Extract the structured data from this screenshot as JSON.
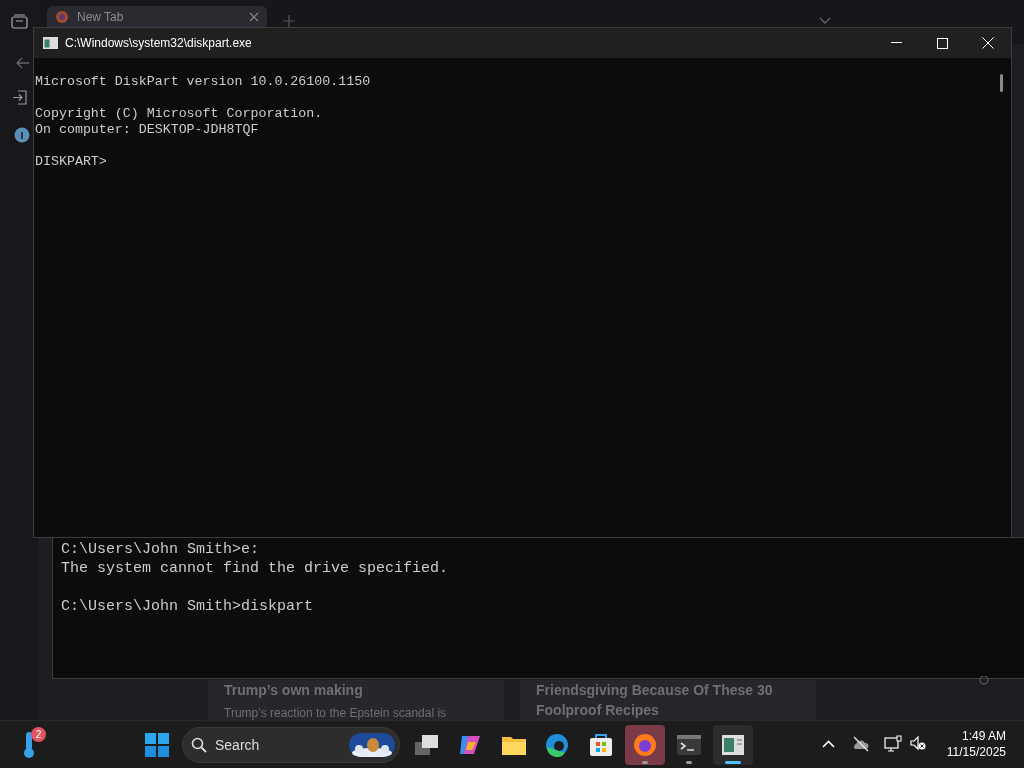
{
  "browser": {
    "tab": {
      "title": "New Tab"
    }
  },
  "console_window": {
    "blocks": [
      [
        "C:\\Users\\John Smith>e:",
        "The system cannot find the drive specified."
      ],
      [
        "C:\\Users\\John Smith>diskpart"
      ]
    ]
  },
  "news": [
    {
      "headline": "Trump’s own making",
      "snippet": "Trump’s reaction to the Epstein scandal is"
    },
    {
      "headline": "Friendsgiving Because Of These 30 Foolproof Recipes"
    }
  ],
  "diskpart_window": {
    "title": "C:\\Windows\\system32\\diskpart.exe",
    "blocks": [
      [
        "Microsoft DiskPart version 10.0.26100.1150"
      ],
      [
        "Copyright (C) Microsoft Corporation.",
        "On computer: DESKTOP-JDH8TQF"
      ],
      [
        "DISKPART>"
      ]
    ]
  },
  "taskbar": {
    "weather_badge": "2",
    "search": {
      "placeholder": "Search"
    },
    "apps": [
      {
        "kind": "start",
        "running": false,
        "selected": false
      },
      {
        "kind": "taskview",
        "running": false,
        "selected": false
      },
      {
        "kind": "copilot",
        "running": false,
        "selected": false
      },
      {
        "kind": "explorer",
        "running": false,
        "selected": false
      },
      {
        "kind": "edge",
        "running": false,
        "selected": false
      },
      {
        "kind": "store",
        "running": false,
        "selected": false
      },
      {
        "kind": "firefox",
        "running": true,
        "selected": false,
        "flashing": true
      },
      {
        "kind": "terminal",
        "running": true,
        "selected": false
      },
      {
        "kind": "console",
        "running": true,
        "selected": true
      }
    ],
    "clock": {
      "time": "1:49 AM",
      "date": "11/15/2025"
    }
  }
}
